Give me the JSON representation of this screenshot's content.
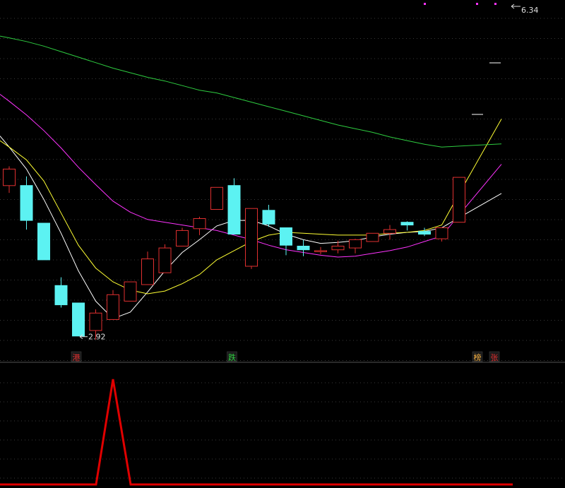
{
  "chart_data": {
    "type": "candlestick",
    "price_range": [
      2.7,
      6.55
    ],
    "indicator_range": [
      0,
      1
    ],
    "candles": [
      {
        "open": 4.55,
        "close": 4.73,
        "high": 4.76,
        "low": 4.47
      },
      {
        "open": 4.55,
        "close": 4.17,
        "high": 4.65,
        "low": 4.07
      },
      {
        "open": 4.14,
        "close": 3.74,
        "high": 4.14,
        "low": 3.74
      },
      {
        "open": 3.46,
        "close": 3.25,
        "high": 3.55,
        "low": 3.22
      },
      {
        "open": 3.27,
        "close": 2.91,
        "high": 3.27,
        "low": 2.91
      },
      {
        "open": 2.97,
        "close": 3.16,
        "high": 3.2,
        "low": 2.87
      },
      {
        "open": 3.09,
        "close": 3.36,
        "high": 3.41,
        "low": 3.09
      },
      {
        "open": 3.29,
        "close": 3.5,
        "high": 3.5,
        "low": 3.29
      },
      {
        "open": 3.47,
        "close": 3.75,
        "high": 3.83,
        "low": 3.47
      },
      {
        "open": 3.6,
        "close": 3.87,
        "high": 3.91,
        "low": 3.6
      },
      {
        "open": 3.89,
        "close": 4.06,
        "high": 4.09,
        "low": 3.89
      },
      {
        "open": 4.08,
        "close": 4.19,
        "high": 4.21,
        "low": 4.01
      },
      {
        "open": 4.29,
        "close": 4.53,
        "high": 4.53,
        "low": 4.29
      },
      {
        "open": 4.55,
        "close": 4.02,
        "high": 4.63,
        "low": 4.02
      },
      {
        "open": 3.67,
        "close": 4.3,
        "high": 4.3,
        "low": 3.64
      },
      {
        "open": 4.28,
        "close": 4.13,
        "high": 4.34,
        "low": 4.1
      },
      {
        "open": 4.09,
        "close": 3.9,
        "high": 4.09,
        "low": 3.79
      },
      {
        "open": 3.89,
        "close": 3.85,
        "high": 3.96,
        "low": 3.78
      },
      {
        "open": 3.83,
        "close": 3.84,
        "high": 3.88,
        "low": 3.8
      },
      {
        "open": 3.85,
        "close": 3.89,
        "high": 3.95,
        "low": 3.81
      },
      {
        "open": 3.87,
        "close": 3.96,
        "high": 3.97,
        "low": 3.81
      },
      {
        "open": 3.94,
        "close": 4.03,
        "high": 4.03,
        "low": 3.94
      },
      {
        "open": 4.03,
        "close": 4.07,
        "high": 4.12,
        "low": 3.96
      },
      {
        "open": 4.15,
        "close": 4.12,
        "high": 4.16,
        "low": 4.06
      },
      {
        "open": 4.05,
        "close": 4.02,
        "high": 4.09,
        "low": 4.0
      },
      {
        "open": 3.97,
        "close": 4.09,
        "high": 4.09,
        "low": 3.94
      },
      {
        "open": 4.15,
        "close": 4.64,
        "high": 4.64,
        "low": 4.15
      }
    ],
    "moving_averages": [
      {
        "color": "#ffffff",
        "values": [
          4.97,
          4.73,
          4.4,
          4.03,
          3.62,
          3.29,
          3.1,
          3.17,
          3.39,
          3.62,
          3.82,
          3.96,
          4.11,
          4.17,
          4.17,
          4.11,
          4.02,
          3.96,
          3.92,
          3.93,
          3.95,
          3.99,
          4.02,
          4.04,
          4.05,
          4.09,
          4.2
        ]
      },
      {
        "color": "#ffff33",
        "values": [
          4.97,
          4.83,
          4.6,
          4.25,
          3.9,
          3.65,
          3.5,
          3.41,
          3.37,
          3.4,
          3.48,
          3.58,
          3.74,
          3.84,
          3.94,
          4.01,
          4.04,
          4.03,
          4.02,
          4.01,
          4.01,
          4.01,
          4.03,
          4.04,
          4.06,
          4.12,
          4.46
        ]
      },
      {
        "color": "#ff33ff",
        "values": [
          5.47,
          5.32,
          5.15,
          4.96,
          4.75,
          4.56,
          4.38,
          4.26,
          4.18,
          4.15,
          4.12,
          4.09,
          4.06,
          4.01,
          3.96,
          3.9,
          3.85,
          3.82,
          3.79,
          3.77,
          3.78,
          3.81,
          3.84,
          3.88,
          3.94,
          4.0,
          4.23
        ]
      },
      {
        "color": "#2ecc40",
        "values": [
          6.16,
          6.12,
          6.07,
          6.01,
          5.95,
          5.89,
          5.83,
          5.78,
          5.73,
          5.69,
          5.64,
          5.59,
          5.56,
          5.51,
          5.46,
          5.41,
          5.36,
          5.31,
          5.26,
          5.21,
          5.17,
          5.13,
          5.08,
          5.04,
          5.0,
          4.97,
          4.98
        ]
      }
    ],
    "min_price_label": "2.92",
    "max_price_label": "6.34",
    "markers": [
      {
        "candle": 4,
        "text": "港",
        "color": "#e03030"
      },
      {
        "candle": 13,
        "text": "跌",
        "color": "#2ecc40"
      },
      {
        "candle": 27,
        "text": "榜",
        "color": "#f5b042"
      },
      {
        "candle": 28,
        "text": "张",
        "color": "#e03030"
      }
    ],
    "indicator": {
      "color": "#e00000",
      "values": [
        0,
        0,
        0,
        0,
        0,
        0,
        1,
        0,
        0,
        0,
        0,
        0,
        0,
        0,
        0,
        0,
        0,
        0,
        0,
        0,
        0,
        0,
        0,
        0,
        0,
        0,
        0,
        0,
        0,
        0
      ]
    },
    "colors": {
      "up": "#e03030",
      "down": "#5cf2f2",
      "grid": "#3a3a3a",
      "divider": "#555555"
    }
  }
}
